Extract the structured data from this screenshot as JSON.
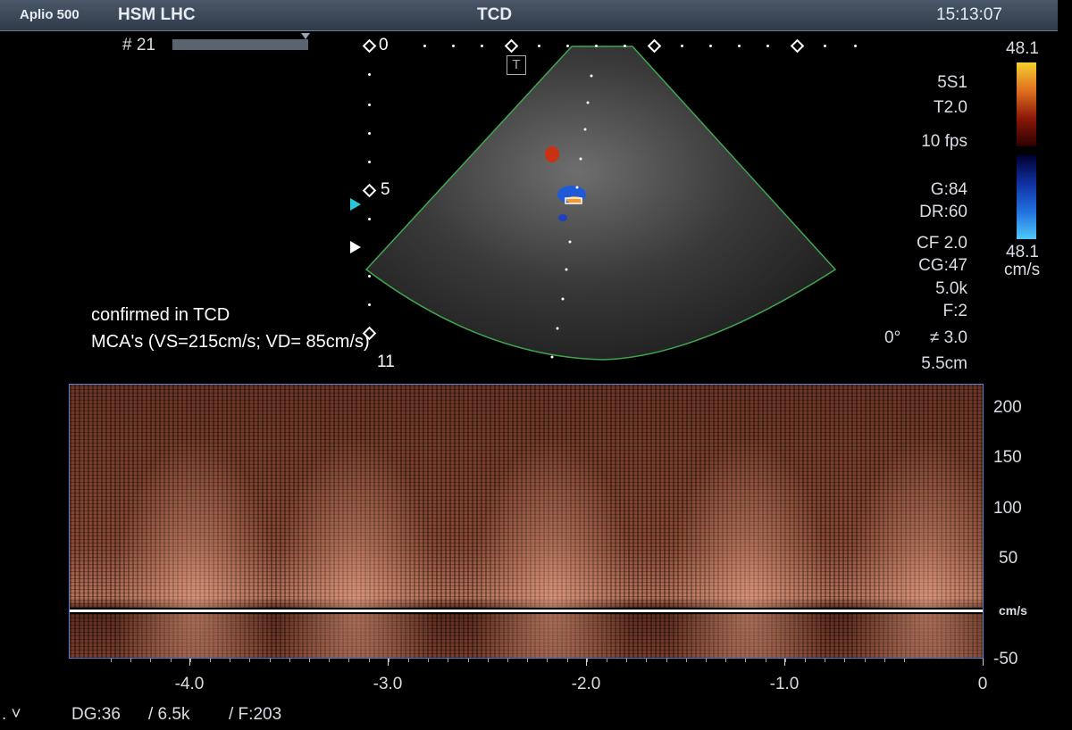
{
  "header": {
    "device": "Aplio 500",
    "institution": "HSM LHC",
    "mode": "TCD",
    "time": "15:13:07"
  },
  "frame": {
    "number": "# 21"
  },
  "depth_scale": {
    "top": "0",
    "mid": "5",
    "bottom": "11"
  },
  "color_bar": {
    "max": "48.1",
    "min": "48.1",
    "unit": "cm/s"
  },
  "params": {
    "probe": "5S1",
    "tissue": "T2.0",
    "fps": "10 fps",
    "gain": "G:84",
    "dr": "DR:60",
    "cf": "CF 2.0",
    "cg": "CG:47",
    "prf": "5.0k",
    "filter": "F:2",
    "angle": "0°",
    "angle_extra": "≠ 3.0",
    "depth": "5.5cm"
  },
  "annotation": {
    "line1": "confirmed in TCD",
    "line2": "MCA's (VS=215cm/s; VD= 85cm/s)"
  },
  "spectral": {
    "velocity_ticks": [
      "200",
      "150",
      "100",
      "50",
      "cm/s",
      "-50"
    ],
    "time_ticks": [
      "-4.0",
      "-3.0",
      "-2.0",
      "-1.0",
      "0"
    ]
  },
  "footer": {
    "marker": ". ˅",
    "dg": "DG:36",
    "prf": "/ 6.5k",
    "filter": "/ F:203"
  },
  "colors": {
    "doppler": "#c87a5c",
    "frame_border": "#5a7fd0",
    "sector_outline": "#3fa84f",
    "color_bar_red": "#f5c022",
    "color_bar_blue": "#3bb6f0"
  }
}
